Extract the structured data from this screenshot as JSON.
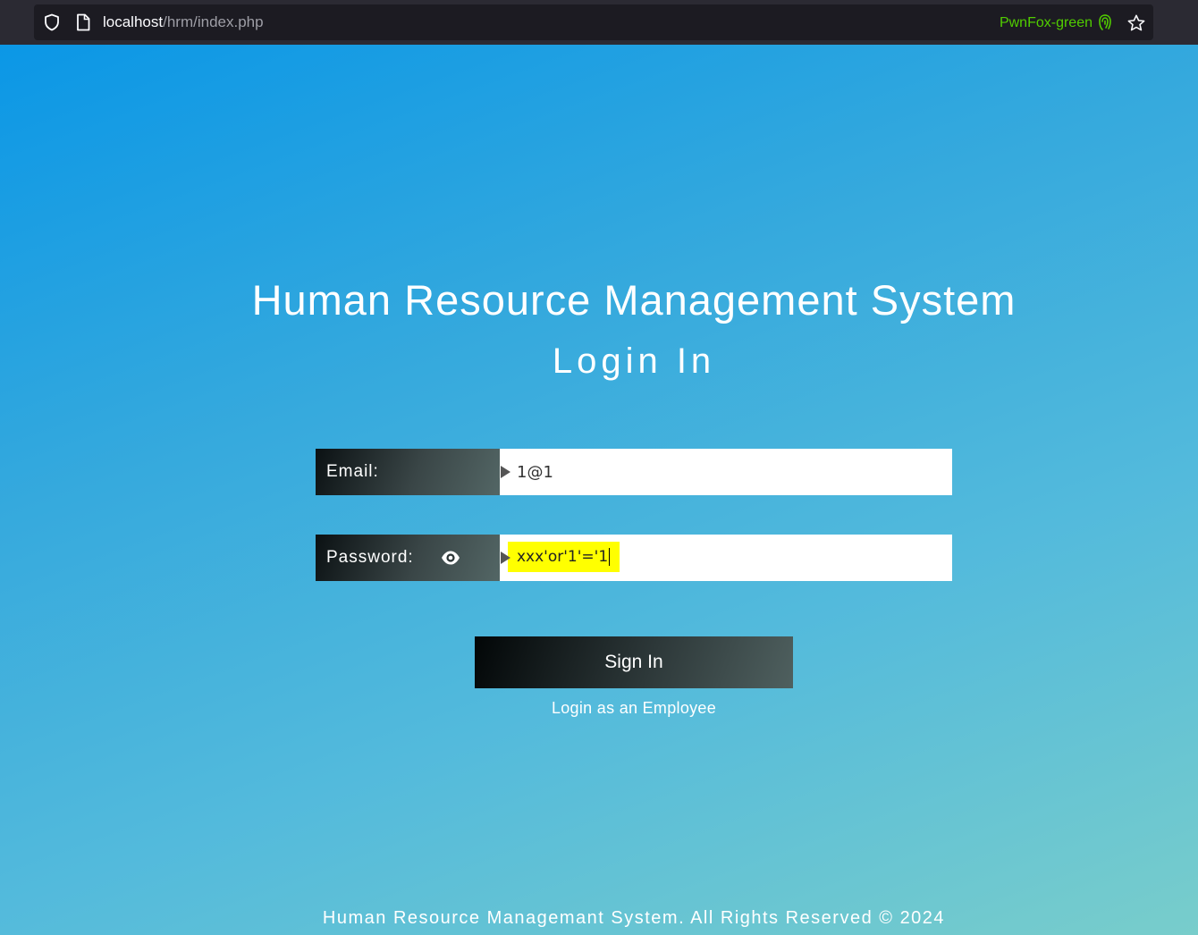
{
  "browser": {
    "url_host": "localhost",
    "url_path": "/hrm/index.php",
    "container_label": "PwnFox-green",
    "icons": [
      "shield-icon",
      "page-icon",
      "fingerprint-icon",
      "star-icon"
    ]
  },
  "page": {
    "title": "Human Resource Management System",
    "subtitle": "Login In",
    "email_label": "Email:",
    "email_value": "1@1",
    "password_label": "Password:",
    "password_value": "xxx'or'1'='1",
    "sign_in_label": "Sign In",
    "employee_link": "Login as an Employee",
    "footer": "Human Resource Managemant System. All Rights Reserved © 2024"
  },
  "colors": {
    "background_top": "#0b97e6",
    "background_bottom": "#78cdcb",
    "highlight": "#ffff00",
    "container_label": "#51cd00"
  }
}
